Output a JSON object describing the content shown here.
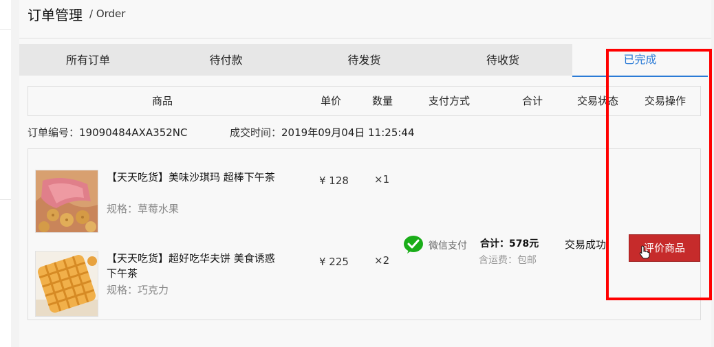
{
  "header": {
    "title": "订单管理",
    "subtitle": "/ Order"
  },
  "tabs": [
    {
      "label": "所有订单",
      "active": false
    },
    {
      "label": "待付款",
      "active": false
    },
    {
      "label": "待发货",
      "active": false
    },
    {
      "label": "待收货",
      "active": false
    },
    {
      "label": "已完成",
      "active": true
    }
  ],
  "table_headers": {
    "product": "商品",
    "unit_price": "单价",
    "quantity": "数量",
    "payment": "支付方式",
    "total": "合计",
    "status": "交易状态",
    "action": "交易操作"
  },
  "order": {
    "number_label": "订单编号：",
    "number": "19090484AXA352NC",
    "time_label": "成交时间：",
    "time": "2019年09月04日 11:25:44",
    "items": [
      {
        "name": "【天天吃货】美味沙琪玛 超棒下午茶",
        "spec": "规格：草莓水果",
        "price": "¥ 128",
        "qty": "×1",
        "image": "shaqima-photo"
      },
      {
        "name": "【天天吃货】超好吃华夫饼 美食诱惑 下午茶",
        "spec": "规格：巧克力",
        "price": "¥ 225",
        "qty": "×2",
        "image": "waffle-photo"
      }
    ],
    "payment_icon": "wechat-pay-icon",
    "payment_method": "微信支付",
    "total_label": "合计：",
    "total_value": "578元",
    "shipping": "含运费：包邮",
    "status": "交易成功",
    "action_button": "评价商品"
  },
  "colors": {
    "accent": "#2b7bd6",
    "button": "#c62b2b",
    "highlight_frame": "#ff0000",
    "wechat_green": "#1aad19"
  }
}
